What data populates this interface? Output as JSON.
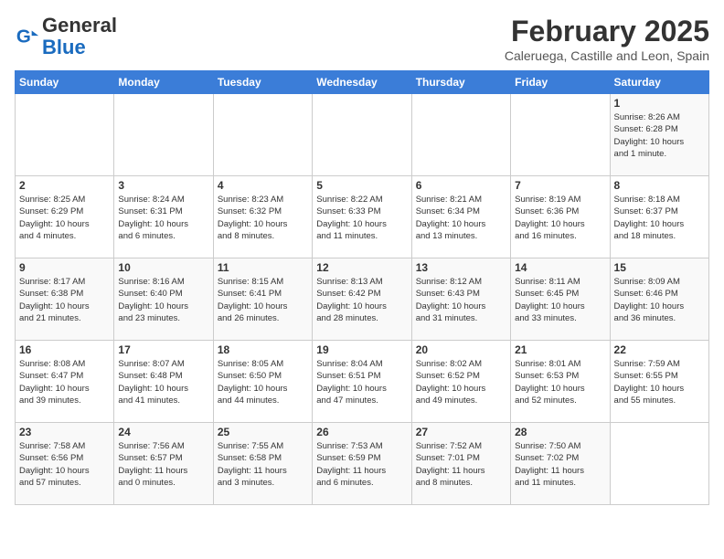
{
  "logo": {
    "line1": "General",
    "line2": "Blue"
  },
  "title": "February 2025",
  "location": "Caleruega, Castille and Leon, Spain",
  "weekdays": [
    "Sunday",
    "Monday",
    "Tuesday",
    "Wednesday",
    "Thursday",
    "Friday",
    "Saturday"
  ],
  "weeks": [
    [
      {
        "day": "",
        "info": ""
      },
      {
        "day": "",
        "info": ""
      },
      {
        "day": "",
        "info": ""
      },
      {
        "day": "",
        "info": ""
      },
      {
        "day": "",
        "info": ""
      },
      {
        "day": "",
        "info": ""
      },
      {
        "day": "1",
        "info": "Sunrise: 8:26 AM\nSunset: 6:28 PM\nDaylight: 10 hours\nand 1 minute."
      }
    ],
    [
      {
        "day": "2",
        "info": "Sunrise: 8:25 AM\nSunset: 6:29 PM\nDaylight: 10 hours\nand 4 minutes."
      },
      {
        "day": "3",
        "info": "Sunrise: 8:24 AM\nSunset: 6:31 PM\nDaylight: 10 hours\nand 6 minutes."
      },
      {
        "day": "4",
        "info": "Sunrise: 8:23 AM\nSunset: 6:32 PM\nDaylight: 10 hours\nand 8 minutes."
      },
      {
        "day": "5",
        "info": "Sunrise: 8:22 AM\nSunset: 6:33 PM\nDaylight: 10 hours\nand 11 minutes."
      },
      {
        "day": "6",
        "info": "Sunrise: 8:21 AM\nSunset: 6:34 PM\nDaylight: 10 hours\nand 13 minutes."
      },
      {
        "day": "7",
        "info": "Sunrise: 8:19 AM\nSunset: 6:36 PM\nDaylight: 10 hours\nand 16 minutes."
      },
      {
        "day": "8",
        "info": "Sunrise: 8:18 AM\nSunset: 6:37 PM\nDaylight: 10 hours\nand 18 minutes."
      }
    ],
    [
      {
        "day": "9",
        "info": "Sunrise: 8:17 AM\nSunset: 6:38 PM\nDaylight: 10 hours\nand 21 minutes."
      },
      {
        "day": "10",
        "info": "Sunrise: 8:16 AM\nSunset: 6:40 PM\nDaylight: 10 hours\nand 23 minutes."
      },
      {
        "day": "11",
        "info": "Sunrise: 8:15 AM\nSunset: 6:41 PM\nDaylight: 10 hours\nand 26 minutes."
      },
      {
        "day": "12",
        "info": "Sunrise: 8:13 AM\nSunset: 6:42 PM\nDaylight: 10 hours\nand 28 minutes."
      },
      {
        "day": "13",
        "info": "Sunrise: 8:12 AM\nSunset: 6:43 PM\nDaylight: 10 hours\nand 31 minutes."
      },
      {
        "day": "14",
        "info": "Sunrise: 8:11 AM\nSunset: 6:45 PM\nDaylight: 10 hours\nand 33 minutes."
      },
      {
        "day": "15",
        "info": "Sunrise: 8:09 AM\nSunset: 6:46 PM\nDaylight: 10 hours\nand 36 minutes."
      }
    ],
    [
      {
        "day": "16",
        "info": "Sunrise: 8:08 AM\nSunset: 6:47 PM\nDaylight: 10 hours\nand 39 minutes."
      },
      {
        "day": "17",
        "info": "Sunrise: 8:07 AM\nSunset: 6:48 PM\nDaylight: 10 hours\nand 41 minutes."
      },
      {
        "day": "18",
        "info": "Sunrise: 8:05 AM\nSunset: 6:50 PM\nDaylight: 10 hours\nand 44 minutes."
      },
      {
        "day": "19",
        "info": "Sunrise: 8:04 AM\nSunset: 6:51 PM\nDaylight: 10 hours\nand 47 minutes."
      },
      {
        "day": "20",
        "info": "Sunrise: 8:02 AM\nSunset: 6:52 PM\nDaylight: 10 hours\nand 49 minutes."
      },
      {
        "day": "21",
        "info": "Sunrise: 8:01 AM\nSunset: 6:53 PM\nDaylight: 10 hours\nand 52 minutes."
      },
      {
        "day": "22",
        "info": "Sunrise: 7:59 AM\nSunset: 6:55 PM\nDaylight: 10 hours\nand 55 minutes."
      }
    ],
    [
      {
        "day": "23",
        "info": "Sunrise: 7:58 AM\nSunset: 6:56 PM\nDaylight: 10 hours\nand 57 minutes."
      },
      {
        "day": "24",
        "info": "Sunrise: 7:56 AM\nSunset: 6:57 PM\nDaylight: 11 hours\nand 0 minutes."
      },
      {
        "day": "25",
        "info": "Sunrise: 7:55 AM\nSunset: 6:58 PM\nDaylight: 11 hours\nand 3 minutes."
      },
      {
        "day": "26",
        "info": "Sunrise: 7:53 AM\nSunset: 6:59 PM\nDaylight: 11 hours\nand 6 minutes."
      },
      {
        "day": "27",
        "info": "Sunrise: 7:52 AM\nSunset: 7:01 PM\nDaylight: 11 hours\nand 8 minutes."
      },
      {
        "day": "28",
        "info": "Sunrise: 7:50 AM\nSunset: 7:02 PM\nDaylight: 11 hours\nand 11 minutes."
      },
      {
        "day": "",
        "info": ""
      }
    ]
  ]
}
